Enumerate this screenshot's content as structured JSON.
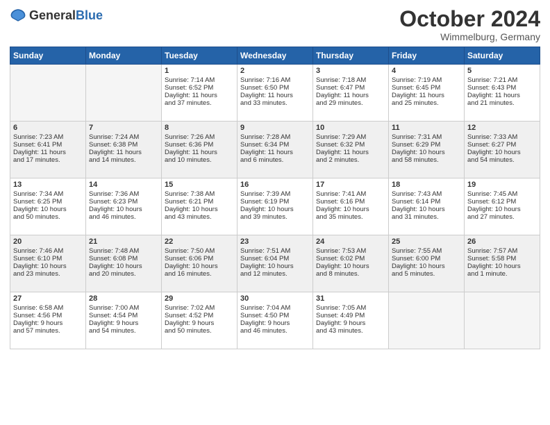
{
  "header": {
    "logo_general": "General",
    "logo_blue": "Blue",
    "month": "October 2024",
    "location": "Wimmelburg, Germany"
  },
  "weekdays": [
    "Sunday",
    "Monday",
    "Tuesday",
    "Wednesday",
    "Thursday",
    "Friday",
    "Saturday"
  ],
  "weeks": [
    [
      {
        "day": "",
        "info": ""
      },
      {
        "day": "",
        "info": ""
      },
      {
        "day": "1",
        "info": "Sunrise: 7:14 AM\nSunset: 6:52 PM\nDaylight: 11 hours\nand 37 minutes."
      },
      {
        "day": "2",
        "info": "Sunrise: 7:16 AM\nSunset: 6:50 PM\nDaylight: 11 hours\nand 33 minutes."
      },
      {
        "day": "3",
        "info": "Sunrise: 7:18 AM\nSunset: 6:47 PM\nDaylight: 11 hours\nand 29 minutes."
      },
      {
        "day": "4",
        "info": "Sunrise: 7:19 AM\nSunset: 6:45 PM\nDaylight: 11 hours\nand 25 minutes."
      },
      {
        "day": "5",
        "info": "Sunrise: 7:21 AM\nSunset: 6:43 PM\nDaylight: 11 hours\nand 21 minutes."
      }
    ],
    [
      {
        "day": "6",
        "info": "Sunrise: 7:23 AM\nSunset: 6:41 PM\nDaylight: 11 hours\nand 17 minutes."
      },
      {
        "day": "7",
        "info": "Sunrise: 7:24 AM\nSunset: 6:38 PM\nDaylight: 11 hours\nand 14 minutes."
      },
      {
        "day": "8",
        "info": "Sunrise: 7:26 AM\nSunset: 6:36 PM\nDaylight: 11 hours\nand 10 minutes."
      },
      {
        "day": "9",
        "info": "Sunrise: 7:28 AM\nSunset: 6:34 PM\nDaylight: 11 hours\nand 6 minutes."
      },
      {
        "day": "10",
        "info": "Sunrise: 7:29 AM\nSunset: 6:32 PM\nDaylight: 11 hours\nand 2 minutes."
      },
      {
        "day": "11",
        "info": "Sunrise: 7:31 AM\nSunset: 6:29 PM\nDaylight: 10 hours\nand 58 minutes."
      },
      {
        "day": "12",
        "info": "Sunrise: 7:33 AM\nSunset: 6:27 PM\nDaylight: 10 hours\nand 54 minutes."
      }
    ],
    [
      {
        "day": "13",
        "info": "Sunrise: 7:34 AM\nSunset: 6:25 PM\nDaylight: 10 hours\nand 50 minutes."
      },
      {
        "day": "14",
        "info": "Sunrise: 7:36 AM\nSunset: 6:23 PM\nDaylight: 10 hours\nand 46 minutes."
      },
      {
        "day": "15",
        "info": "Sunrise: 7:38 AM\nSunset: 6:21 PM\nDaylight: 10 hours\nand 43 minutes."
      },
      {
        "day": "16",
        "info": "Sunrise: 7:39 AM\nSunset: 6:19 PM\nDaylight: 10 hours\nand 39 minutes."
      },
      {
        "day": "17",
        "info": "Sunrise: 7:41 AM\nSunset: 6:16 PM\nDaylight: 10 hours\nand 35 minutes."
      },
      {
        "day": "18",
        "info": "Sunrise: 7:43 AM\nSunset: 6:14 PM\nDaylight: 10 hours\nand 31 minutes."
      },
      {
        "day": "19",
        "info": "Sunrise: 7:45 AM\nSunset: 6:12 PM\nDaylight: 10 hours\nand 27 minutes."
      }
    ],
    [
      {
        "day": "20",
        "info": "Sunrise: 7:46 AM\nSunset: 6:10 PM\nDaylight: 10 hours\nand 23 minutes."
      },
      {
        "day": "21",
        "info": "Sunrise: 7:48 AM\nSunset: 6:08 PM\nDaylight: 10 hours\nand 20 minutes."
      },
      {
        "day": "22",
        "info": "Sunrise: 7:50 AM\nSunset: 6:06 PM\nDaylight: 10 hours\nand 16 minutes."
      },
      {
        "day": "23",
        "info": "Sunrise: 7:51 AM\nSunset: 6:04 PM\nDaylight: 10 hours\nand 12 minutes."
      },
      {
        "day": "24",
        "info": "Sunrise: 7:53 AM\nSunset: 6:02 PM\nDaylight: 10 hours\nand 8 minutes."
      },
      {
        "day": "25",
        "info": "Sunrise: 7:55 AM\nSunset: 6:00 PM\nDaylight: 10 hours\nand 5 minutes."
      },
      {
        "day": "26",
        "info": "Sunrise: 7:57 AM\nSunset: 5:58 PM\nDaylight: 10 hours\nand 1 minute."
      }
    ],
    [
      {
        "day": "27",
        "info": "Sunrise: 6:58 AM\nSunset: 4:56 PM\nDaylight: 9 hours\nand 57 minutes."
      },
      {
        "day": "28",
        "info": "Sunrise: 7:00 AM\nSunset: 4:54 PM\nDaylight: 9 hours\nand 54 minutes."
      },
      {
        "day": "29",
        "info": "Sunrise: 7:02 AM\nSunset: 4:52 PM\nDaylight: 9 hours\nand 50 minutes."
      },
      {
        "day": "30",
        "info": "Sunrise: 7:04 AM\nSunset: 4:50 PM\nDaylight: 9 hours\nand 46 minutes."
      },
      {
        "day": "31",
        "info": "Sunrise: 7:05 AM\nSunset: 4:49 PM\nDaylight: 9 hours\nand 43 minutes."
      },
      {
        "day": "",
        "info": ""
      },
      {
        "day": "",
        "info": ""
      }
    ]
  ]
}
